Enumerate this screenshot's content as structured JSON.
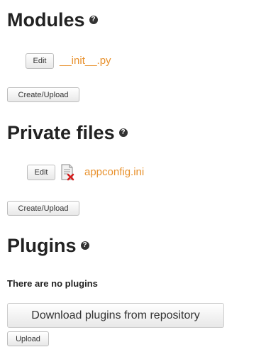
{
  "modules": {
    "title": "Modules",
    "help_glyph": "?",
    "files": [
      {
        "edit_label": "Edit",
        "name": "__init__.py"
      }
    ],
    "create_label": "Create/Upload"
  },
  "private_files": {
    "title": "Private files",
    "help_glyph": "?",
    "files": [
      {
        "edit_label": "Edit",
        "name": "appconfig.ini",
        "icon": "file-delete-icon"
      }
    ],
    "create_label": "Create/Upload"
  },
  "plugins": {
    "title": "Plugins",
    "help_glyph": "?",
    "empty_text": "There are no plugins",
    "download_label": "Download plugins from repository",
    "upload_label": "Upload"
  },
  "colors": {
    "link": "#e8912d",
    "heading": "#222222"
  }
}
